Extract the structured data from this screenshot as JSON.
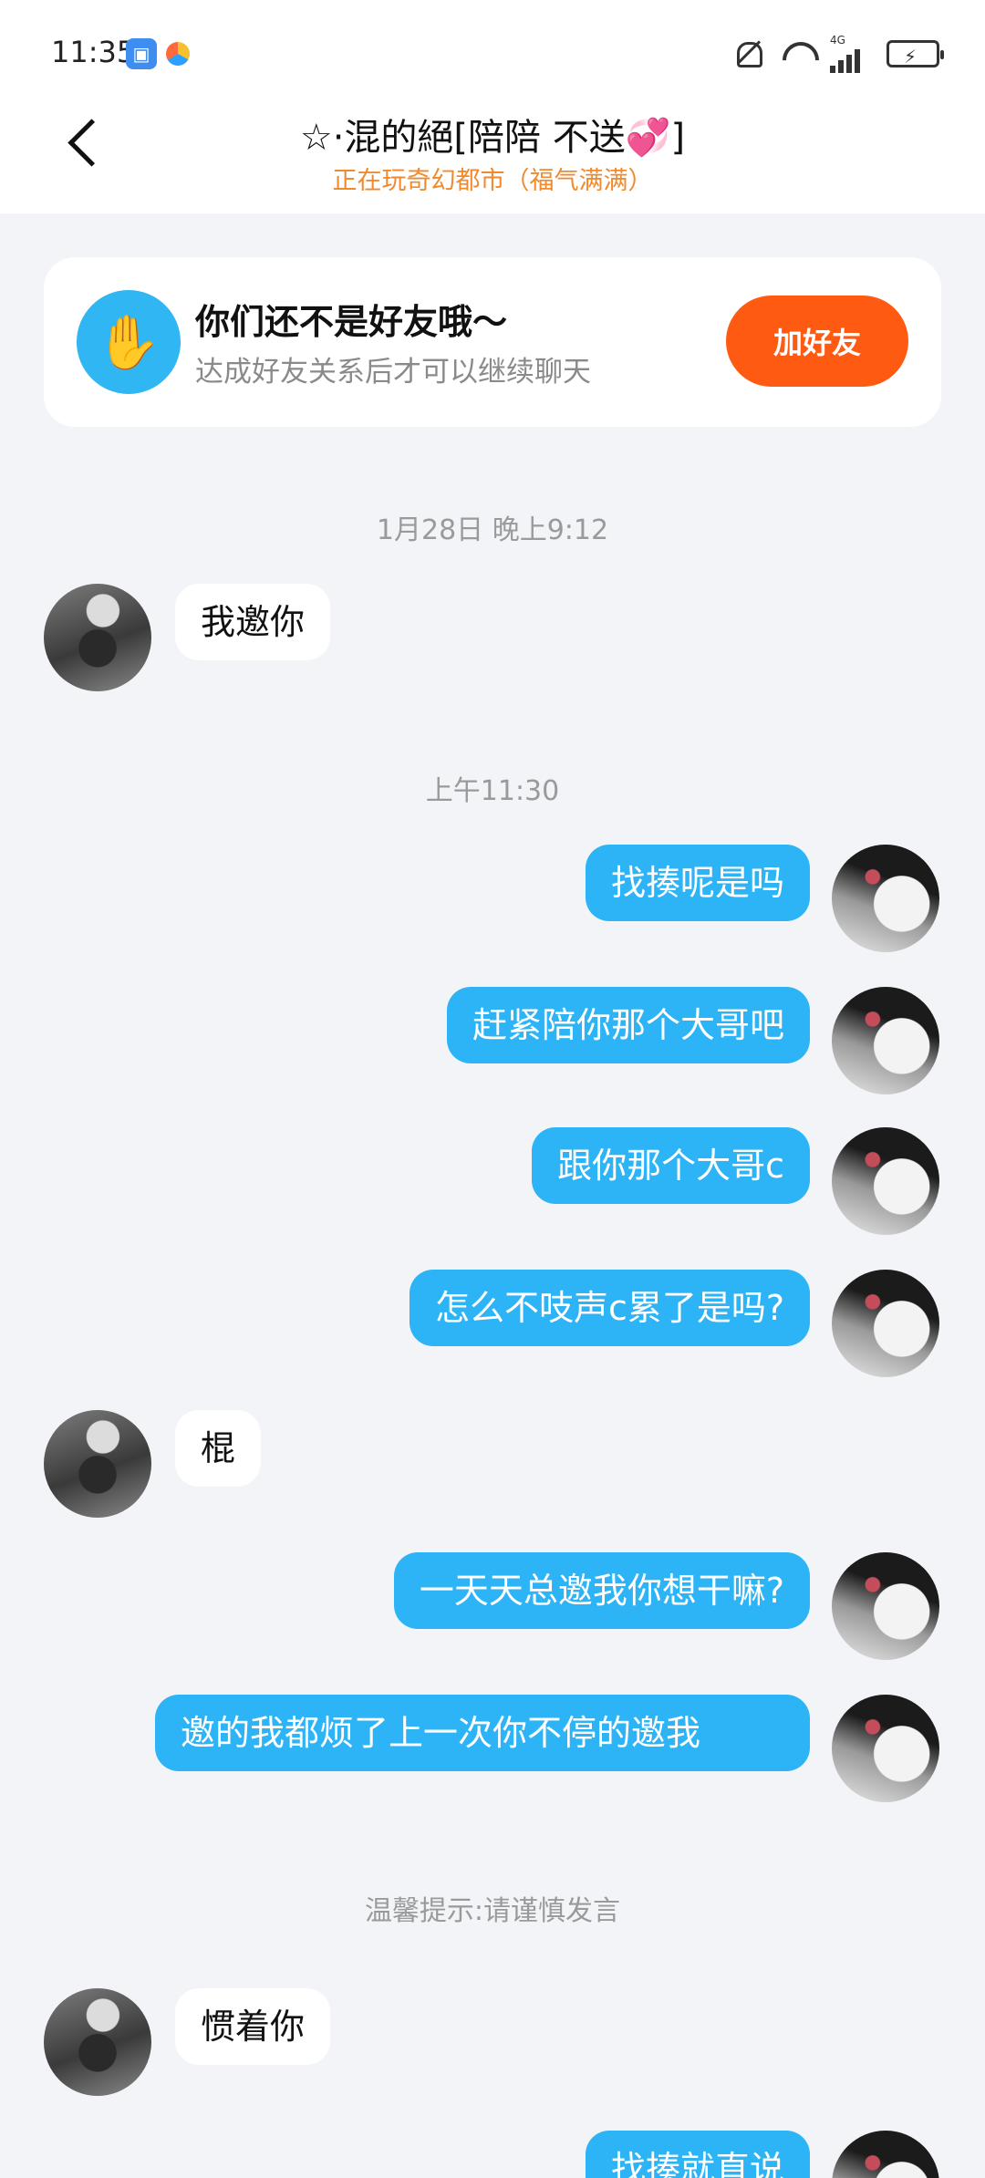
{
  "status_bar": {
    "time": "11:35",
    "icons": [
      "app-badge-icon",
      "weather-app-icon",
      "bell-muted-icon",
      "wifi-icon",
      "signal-icon",
      "battery-charging-icon"
    ],
    "network_label": "4G"
  },
  "header": {
    "back_icon": "chevron-left-icon",
    "title": "☆·混的絕[陪陪  不送💞]",
    "subtitle": "正在玩奇幻都市（福气满满）"
  },
  "friend_banner": {
    "icon": "waving-hand-icon",
    "title": "你们还不是好友哦～",
    "description": "达成好友关系后才可以继续聊天",
    "button_label": "加好友",
    "accent_color": "#ff5a12"
  },
  "timestamps": [
    "1月28日 晚上9:12",
    "上午11:30"
  ],
  "tip": "温馨提示:请谨慎发言",
  "messages": [
    {
      "side": "in",
      "text": "我邀你"
    },
    {
      "side": "out",
      "text": "找揍呢是吗"
    },
    {
      "side": "out",
      "text": "赶紧陪你那个大哥吧"
    },
    {
      "side": "out",
      "text": "跟你那个大哥c"
    },
    {
      "side": "out",
      "text": "怎么不吱声c累了是吗?"
    },
    {
      "side": "in",
      "text": "棍"
    },
    {
      "side": "out",
      "text": "一天天总邀我你想干嘛?"
    },
    {
      "side": "out",
      "text": "邀的我都烦了上一次你不停的邀我"
    },
    {
      "side": "in",
      "text": "惯着你"
    },
    {
      "side": "out",
      "text": "找揍就直说"
    }
  ],
  "colors": {
    "outgoing_bubble": "#2db4f6",
    "incoming_bubble": "#ffffff",
    "background": "#f2f4f7"
  }
}
